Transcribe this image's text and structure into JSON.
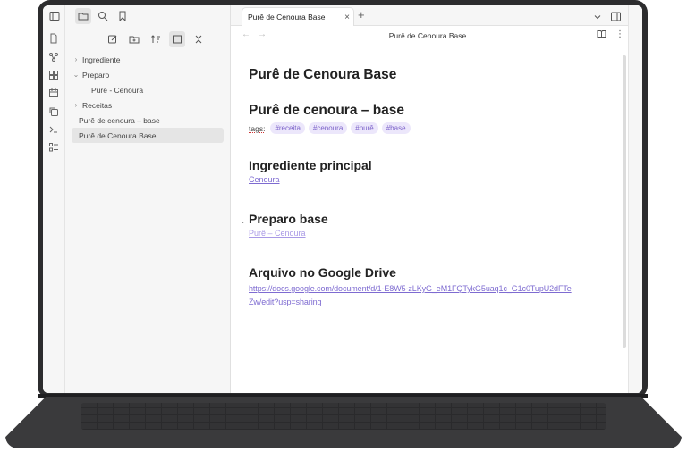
{
  "colors": {
    "accent": "#7e6bd1",
    "tag_bg": "#ece7fb",
    "sidebar_bg": "#f6f6f6",
    "device_frame": "#2c2c2e"
  },
  "ribbon": {
    "icons": [
      "file-icon",
      "graph-icon",
      "canvas-icon",
      "calendar-icon",
      "copy-icon",
      "terminal-icon",
      "template-icon"
    ]
  },
  "sidebar": {
    "top_tools": [
      "sidebar-toggle-icon",
      "folder-icon",
      "search-icon",
      "bookmark-icon"
    ],
    "actions": [
      "new-note-icon",
      "new-folder-icon",
      "sort-icon",
      "collapse-view-icon",
      "collapse-all-icon"
    ],
    "tree": [
      {
        "label": "Ingrediente",
        "chevron": "›",
        "indent": 0
      },
      {
        "label": "Preparo",
        "chevron": "⌄",
        "indent": 0
      },
      {
        "label": "Purê - Cenoura",
        "chevron": "",
        "indent": 1
      },
      {
        "label": "Receitas",
        "chevron": "›",
        "indent": 0
      },
      {
        "label": "Purê de cenoura – base",
        "chevron": "",
        "indent": 0
      },
      {
        "label": "Purê de Cenoura Base",
        "chevron": "",
        "indent": 0
      }
    ]
  },
  "tabs": {
    "active_title": "Purê de Cenoura Base",
    "close": "×",
    "add": "+"
  },
  "nav": {
    "back": "←",
    "forward": "→",
    "title": "Purê de Cenoura Base"
  },
  "note": {
    "title": "Purê de Cenoura Base",
    "heading1": "Purê de cenoura – base",
    "tags_label": "tags:",
    "tags": [
      "#receita",
      "#cenoura",
      "#purê",
      "#base"
    ],
    "heading2": "Ingrediente principal",
    "link2": "Cenoura",
    "heading3": "Preparo base",
    "link3": "Purê – Cenoura",
    "heading4": "Arquivo no Google Drive",
    "url_line1": "https://docs.google.com/document/d/1-E8W5-zLKyG_eM1FQTykG5uaq1c_G1c0TupU2dFTe",
    "url_line2": "Zw/edit?usp=sharing"
  }
}
